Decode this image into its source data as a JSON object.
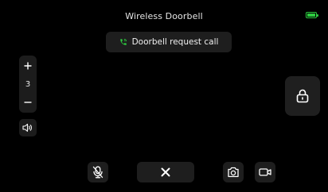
{
  "app": {
    "title": "Wireless Doorbell"
  },
  "status": {
    "battery_color": "#2ecc40"
  },
  "banner": {
    "icon": "phone-call-icon",
    "text": "Doorbell request call",
    "icon_color": "#2ecc40"
  },
  "volume": {
    "increase_icon": "plus-icon",
    "level": "3",
    "decrease_icon": "minus-icon",
    "speaker_icon": "speaker-icon"
  },
  "actions": {
    "unlock_icon": "lock-icon",
    "mute_icon": "mic-off-icon",
    "hangup_icon": "close-icon",
    "snapshot_icon": "camera-icon",
    "record_icon": "video-icon"
  }
}
